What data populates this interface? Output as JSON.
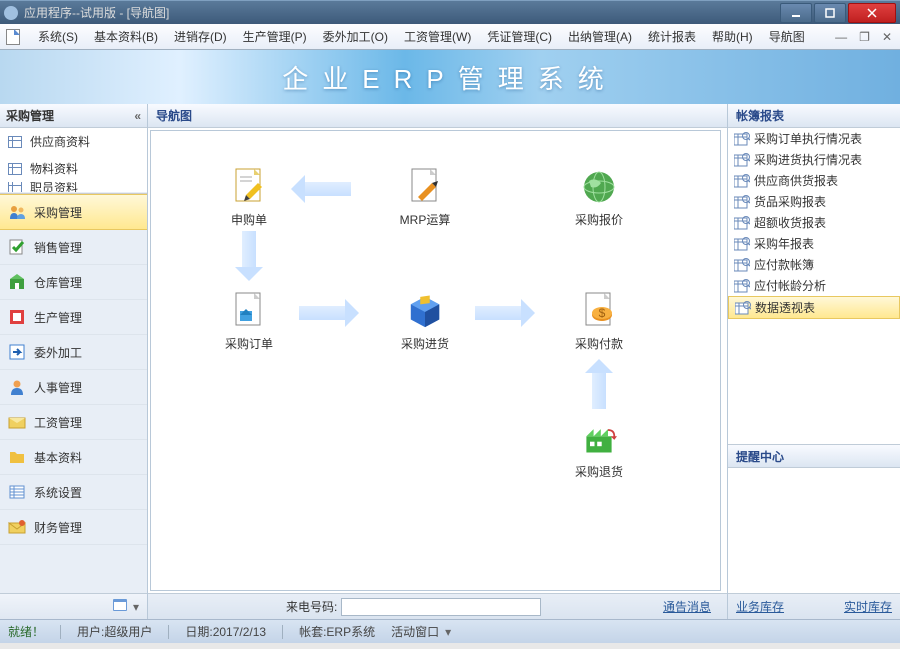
{
  "window": {
    "title": "应用程序--试用版 - [导航图]"
  },
  "menu": {
    "items": [
      "系统(S)",
      "基本资料(B)",
      "进销存(D)",
      "生产管理(P)",
      "委外加工(O)",
      "工资管理(W)",
      "凭证管理(C)",
      "出纳管理(A)",
      "统计报表",
      "帮助(H)",
      "导航图"
    ]
  },
  "banner": {
    "title": "企业ERP管理系统"
  },
  "sidebar": {
    "header": "采购管理",
    "top_items": [
      "供应商资料",
      "物料资料",
      "职员资料"
    ],
    "modules": [
      {
        "label": "采购管理",
        "icon": "users",
        "active": true
      },
      {
        "label": "销售管理",
        "icon": "check",
        "active": false
      },
      {
        "label": "仓库管理",
        "icon": "warehouse",
        "active": false
      },
      {
        "label": "生产管理",
        "icon": "prod",
        "active": false
      },
      {
        "label": "委外加工",
        "icon": "outsrc",
        "active": false
      },
      {
        "label": "人事管理",
        "icon": "hr",
        "active": false
      },
      {
        "label": "工资管理",
        "icon": "salary",
        "active": false
      },
      {
        "label": "基本资料",
        "icon": "folder",
        "active": false
      },
      {
        "label": "系统设置",
        "icon": "settings",
        "active": false
      },
      {
        "label": "财务管理",
        "icon": "finance",
        "active": false
      }
    ]
  },
  "center": {
    "title": "导航图",
    "nodes": {
      "n1": "申购单",
      "n2": "MRP运算",
      "n3": "采购报价",
      "n4": "采购订单",
      "n5": "采购进货",
      "n6": "采购付款",
      "n7": "采购退货"
    },
    "tel_label": "来电号码:",
    "notice": "通告消息"
  },
  "right": {
    "section1_title": "帐簿报表",
    "reports": [
      "采购订单执行情况表",
      "采购进货执行情况表",
      "供应商供货报表",
      "货品采购报表",
      "超额收货报表",
      "采购年报表",
      "应付款帐簿",
      "应付帐龄分析",
      "数据透视表"
    ],
    "report_selected_index": 8,
    "section2_title": "提醒中心",
    "bottom_links": [
      "业务库存",
      "实时库存"
    ]
  },
  "status": {
    "ready": "就绪！",
    "user_label": "用户:超级用户",
    "date_label": "日期:2017/2/13",
    "acct_label": "帐套:ERP系统",
    "active_win": "活动窗口"
  },
  "colors": {
    "accent": "#2a5a9a",
    "sel_bg": "#ffe890"
  }
}
